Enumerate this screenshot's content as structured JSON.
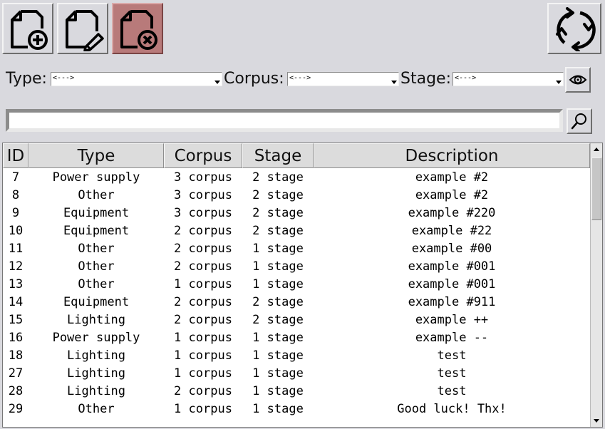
{
  "toolbar": {
    "buttons": [
      {
        "name": "add-document",
        "icon": "document-plus-icon"
      },
      {
        "name": "edit-document",
        "icon": "document-pencil-icon"
      },
      {
        "name": "delete-document",
        "icon": "document-x-icon"
      },
      {
        "name": "refresh",
        "icon": "refresh-arrows-icon"
      }
    ],
    "delete_color": "#b87a7a"
  },
  "filters": {
    "type_label": "Type:",
    "type_value": "<--->",
    "corpus_label": "Corpus:",
    "corpus_value": "<--->",
    "stage_label": "Stage:",
    "stage_value": "<--->",
    "view_icon": "eye-icon"
  },
  "search": {
    "value": "",
    "icon": "magnifier-icon"
  },
  "table": {
    "columns": [
      "ID",
      "Type",
      "Corpus",
      "Stage",
      "Description"
    ],
    "rows": [
      {
        "id": "7",
        "type": "Power supply",
        "corpus": "3 corpus",
        "stage": "2 stage",
        "description": "example #2"
      },
      {
        "id": "8",
        "type": "Other",
        "corpus": "3 corpus",
        "stage": "2 stage",
        "description": "example #2"
      },
      {
        "id": "9",
        "type": "Equipment",
        "corpus": "3 corpus",
        "stage": "2 stage",
        "description": "example #220"
      },
      {
        "id": "10",
        "type": "Equipment",
        "corpus": "2 corpus",
        "stage": "2 stage",
        "description": "example #22"
      },
      {
        "id": "11",
        "type": "Other",
        "corpus": "2 corpus",
        "stage": "1 stage",
        "description": "example #00"
      },
      {
        "id": "12",
        "type": "Other",
        "corpus": "2 corpus",
        "stage": "1 stage",
        "description": "example #001"
      },
      {
        "id": "13",
        "type": "Other",
        "corpus": "1 corpus",
        "stage": "1 stage",
        "description": "example #001"
      },
      {
        "id": "14",
        "type": "Equipment",
        "corpus": "2 corpus",
        "stage": "2 stage",
        "description": "example #911"
      },
      {
        "id": "15",
        "type": "Lighting",
        "corpus": "2 corpus",
        "stage": "2 stage",
        "description": "example ++"
      },
      {
        "id": "16",
        "type": "Power supply",
        "corpus": "1 corpus",
        "stage": "1 stage",
        "description": "example --"
      },
      {
        "id": "18",
        "type": "Lighting",
        "corpus": "1 corpus",
        "stage": "1 stage",
        "description": "test"
      },
      {
        "id": "27",
        "type": "Lighting",
        "corpus": "1 corpus",
        "stage": "1 stage",
        "description": "test"
      },
      {
        "id": "28",
        "type": "Lighting",
        "corpus": "2 corpus",
        "stage": "1 stage",
        "description": "test"
      },
      {
        "id": "29",
        "type": "Other",
        "corpus": "1 corpus",
        "stage": "1 stage",
        "description": "Good luck! Thx!"
      }
    ]
  }
}
